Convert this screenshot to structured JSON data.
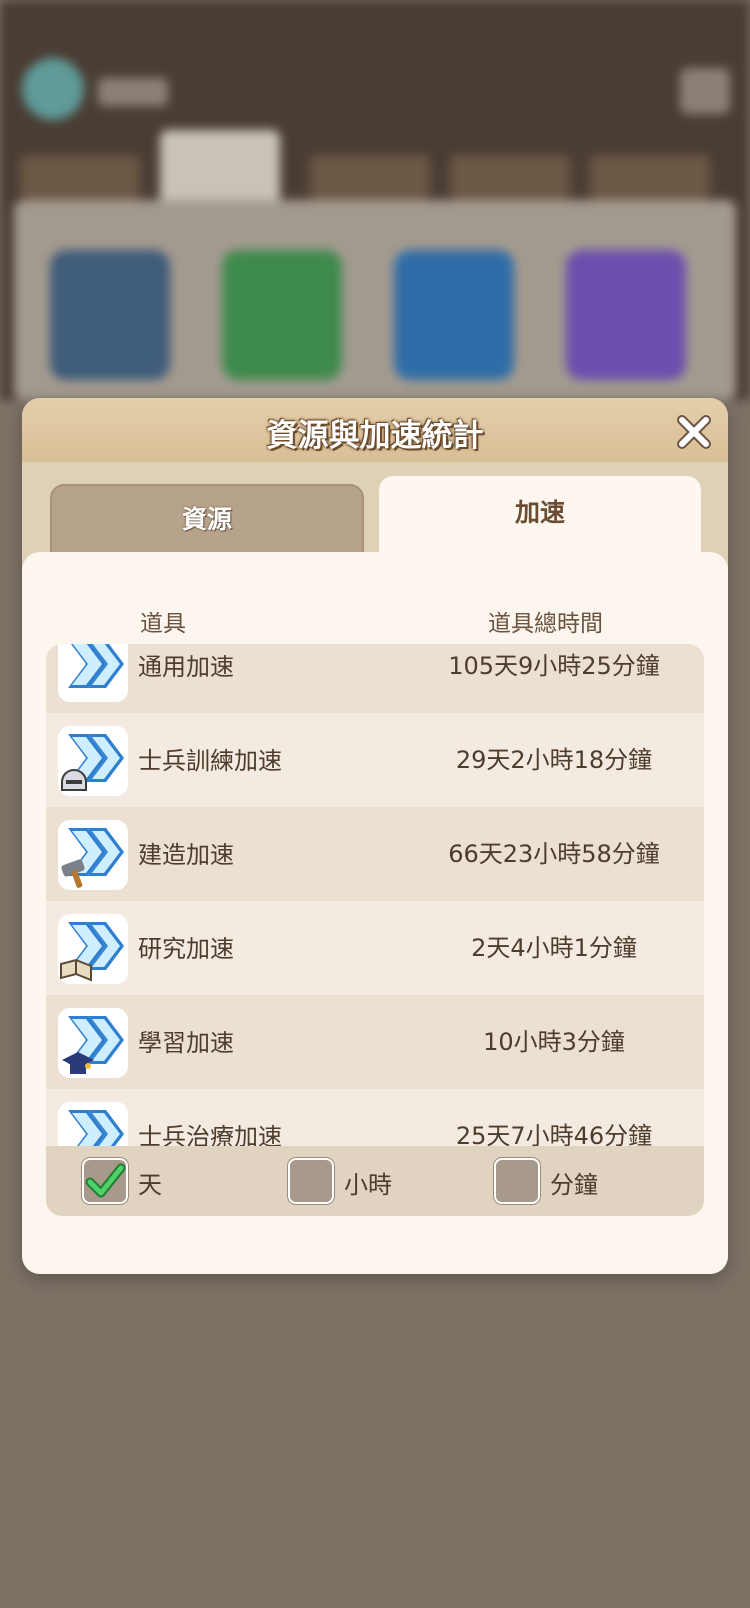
{
  "background": {
    "tab_count": 5,
    "card_colors": [
      "#3f5c7a",
      "#3f8a4d",
      "#2f6da8",
      "#6a4fae"
    ]
  },
  "modal": {
    "title": "資源與加速統計",
    "tabs": [
      {
        "label": "資源",
        "active": false
      },
      {
        "label": "加速",
        "active": true
      }
    ],
    "columns": {
      "item": "道具",
      "total_time": "道具總時間"
    },
    "rows": [
      {
        "name": "通用加速",
        "time": "105天9小時25分鐘",
        "badge": "none"
      },
      {
        "name": "士兵訓練加速",
        "time": "29天2小時18分鐘",
        "badge": "helmet"
      },
      {
        "name": "建造加速",
        "time": "66天23小時58分鐘",
        "badge": "hammer"
      },
      {
        "name": "研究加速",
        "time": "2天4小時1分鐘",
        "badge": "book"
      },
      {
        "name": "學習加速",
        "time": "10小時3分鐘",
        "badge": "cap"
      },
      {
        "name": "士兵治療加速",
        "time": "25天7小時46分鐘",
        "badge": "cross"
      }
    ],
    "filters": [
      {
        "label": "天",
        "checked": true
      },
      {
        "label": "小時",
        "checked": false
      },
      {
        "label": "分鐘",
        "checked": false
      }
    ]
  },
  "colors": {
    "header": "#dcc49e",
    "panel": "#fcf6ee",
    "text": "#4e3c2d",
    "check_green": "#3ec25a"
  }
}
